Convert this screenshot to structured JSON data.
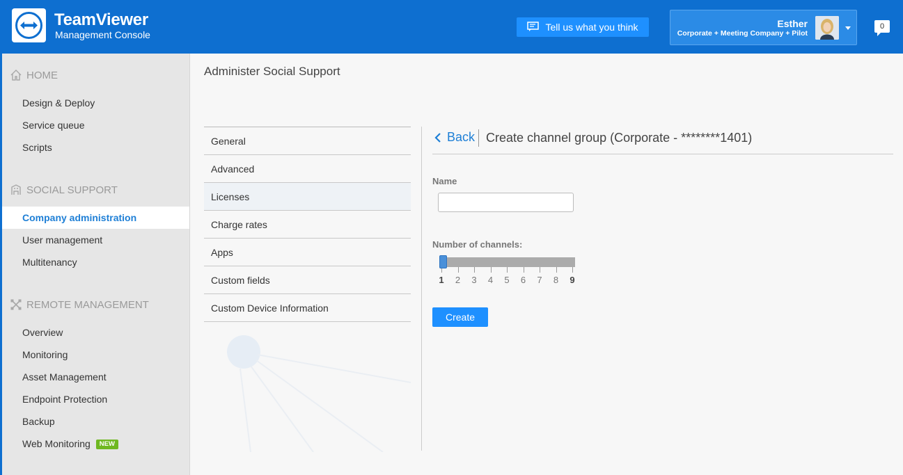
{
  "header": {
    "brand_title": "TeamViewer",
    "brand_subtitle": "Management Console",
    "feedback_label": "Tell us what you think",
    "user_name": "Esther",
    "user_org": "Corporate + Meeting Company + Pilot",
    "notification_count": "0",
    "bg_color": "#0e6fd0"
  },
  "sidebar": {
    "home": {
      "title": "HOME",
      "items": [
        "Design & Deploy",
        "Service queue",
        "Scripts"
      ]
    },
    "social": {
      "title": "SOCIAL SUPPORT",
      "items": [
        "Company administration",
        "User management",
        "Multitenancy"
      ],
      "active": "Company administration"
    },
    "remote": {
      "title": "REMOTE MANAGEMENT",
      "items": [
        "Overview",
        "Monitoring",
        "Asset Management",
        "Endpoint Protection",
        "Backup",
        "Web Monitoring"
      ],
      "new_badge": "NEW"
    }
  },
  "main": {
    "page_title": "Administer Social Support",
    "menu": [
      "General",
      "Advanced",
      "Licenses",
      "Charge rates",
      "Apps",
      "Custom fields",
      "Custom Device Information"
    ],
    "selected_menu": "Licenses",
    "back_label": "Back",
    "panel_title": "Create channel group (Corporate - ********1401)",
    "name_label": "Name",
    "name_value": "",
    "channels_label": "Number of channels:",
    "channels_min": 1,
    "channels_max": 9,
    "channels_value": 1,
    "tick_labels": [
      "1",
      "2",
      "3",
      "4",
      "5",
      "6",
      "7",
      "8",
      "9"
    ],
    "create_label": "Create",
    "accent_color": "#1e90ff"
  }
}
